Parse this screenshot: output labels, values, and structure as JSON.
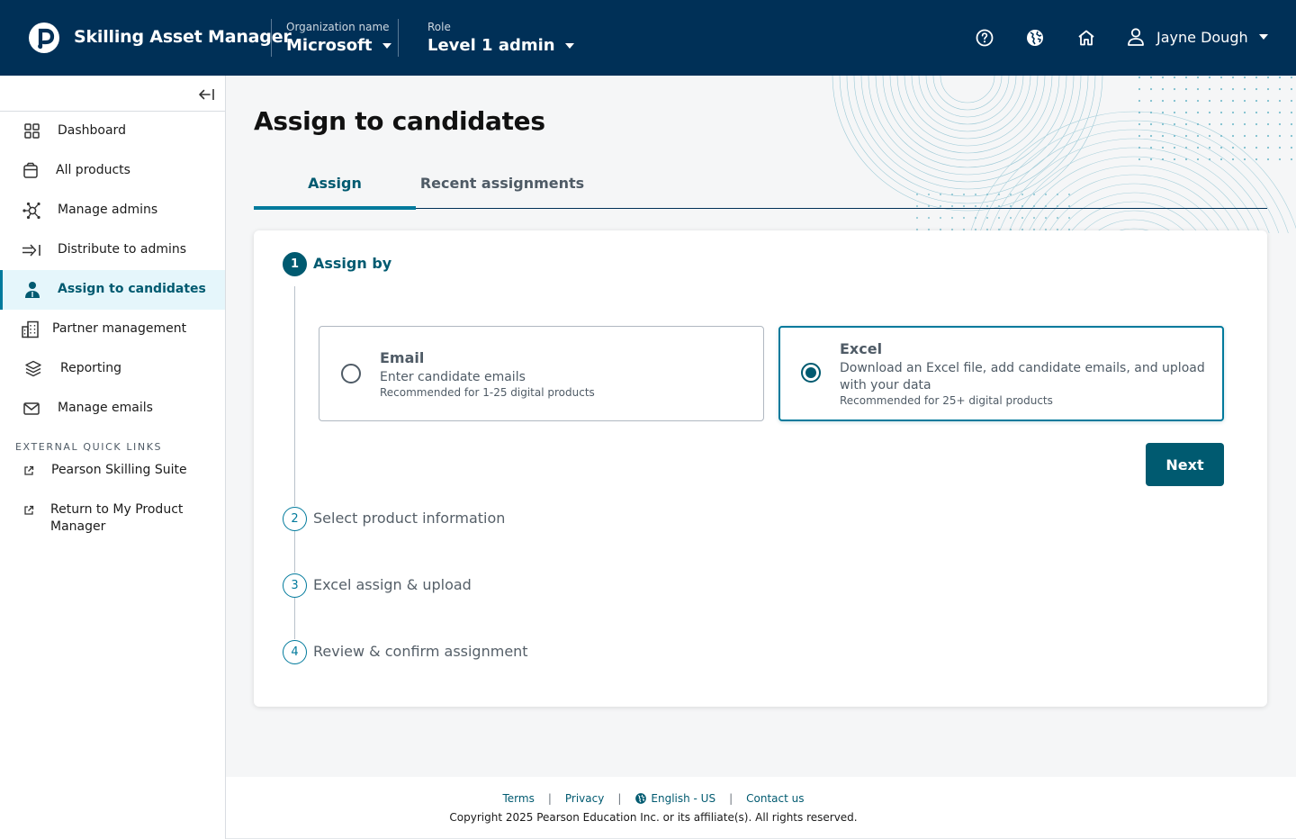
{
  "header": {
    "app_title": "Skilling Asset Manager",
    "org_label": "Organization name",
    "org_value": "Microsoft",
    "role_label": "Role",
    "role_value": "Level 1 admin",
    "user_name": "Jayne Dough",
    "icons": [
      "help-icon",
      "globe-icon",
      "home-icon",
      "user-icon"
    ],
    "background_color": "#003057"
  },
  "sidebar": {
    "items": [
      {
        "label": "Dashboard",
        "icon": "grid-icon"
      },
      {
        "label": "All products",
        "icon": "box-icon"
      },
      {
        "label": "Manage admins",
        "icon": "network-icon"
      },
      {
        "label": "Distribute to admins",
        "icon": "arrow-distribute-icon"
      },
      {
        "label": "Assign to candidates",
        "icon": "person-icon",
        "active": true
      },
      {
        "label": "Partner management",
        "icon": "building-icon"
      },
      {
        "label": "Reporting",
        "icon": "layers-icon"
      },
      {
        "label": "Manage emails",
        "icon": "mail-icon"
      }
    ],
    "quick_links_heading": "EXTERNAL QUICK LINKS",
    "quick_links": [
      {
        "label": "Pearson Skilling Suite",
        "icon": "external-link-icon"
      },
      {
        "label": "Return to My Product Manager",
        "icon": "external-link-icon"
      }
    ]
  },
  "main": {
    "title": "Assign to candidates",
    "tabs": [
      {
        "label": "Assign",
        "active": true
      },
      {
        "label": "Recent assignments",
        "active": false
      }
    ],
    "steps": [
      {
        "number": "1",
        "label": "Assign by",
        "active": true
      },
      {
        "number": "2",
        "label": "Select product information",
        "active": false
      },
      {
        "number": "3",
        "label": "Excel assign & upload",
        "active": false
      },
      {
        "number": "4",
        "label": "Review & confirm assignment",
        "active": false
      }
    ],
    "options": {
      "email": {
        "title": "Email",
        "description": "Enter candidate emails",
        "recommendation": "Recommended for 1-25 digital products",
        "selected": false
      },
      "excel": {
        "title": "Excel",
        "description": "Download an Excel file, add candidate emails, and upload with your data",
        "recommendation": "Recommended for 25+ digital products",
        "selected": true
      }
    },
    "next_label": "Next"
  },
  "footer": {
    "terms": "Terms",
    "privacy": "Privacy",
    "language": "English - US",
    "contact": "Contact us",
    "copyright": "Copyright 2025 Pearson Education Inc. or its affiliate(s). All rights reserved."
  },
  "colors": {
    "primary": "#005a70",
    "accent": "#007a9c",
    "active_nav_bg": "#e5f6fb"
  }
}
